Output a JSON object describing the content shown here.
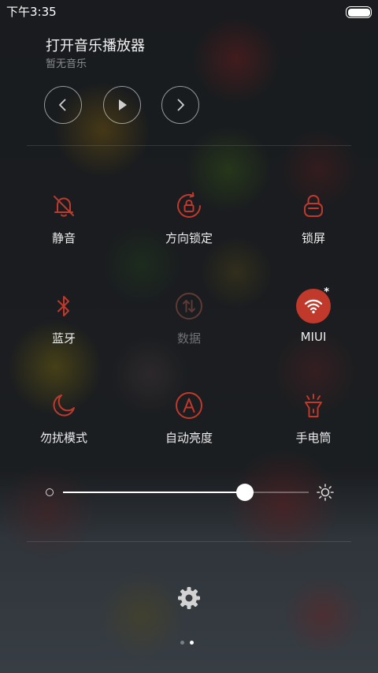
{
  "status_bar": {
    "time": "下午3:35"
  },
  "music": {
    "title": "打开音乐播放器",
    "subtitle": "暂无音乐",
    "buttons": [
      "chevron-left-icon",
      "play-icon",
      "chevron-right-icon"
    ]
  },
  "toggles": [
    {
      "label": "静音",
      "icon": "bell-off-icon",
      "active": false
    },
    {
      "label": "方向锁定",
      "icon": "rotation-lock-icon",
      "active": false
    },
    {
      "label": "锁屏",
      "icon": "lock-icon",
      "active": false
    },
    {
      "label": "蓝牙",
      "icon": "bluetooth-icon",
      "active": false
    },
    {
      "label": "数据",
      "icon": "mobile-data-icon",
      "active": false,
      "disabled": true
    },
    {
      "label": "MIUI",
      "icon": "wifi-icon",
      "active": true
    },
    {
      "label": "勿扰模式",
      "icon": "moon-icon",
      "active": false
    },
    {
      "label": "自动亮度",
      "icon": "auto-brightness-icon",
      "active": false
    },
    {
      "label": "手电筒",
      "icon": "flashlight-icon",
      "active": false
    }
  ],
  "brightness": {
    "level": 0.74
  },
  "page_indicator": {
    "count": 2,
    "current": 2
  },
  "colors": {
    "accent": "#c0392b",
    "icon_red": "#c0392b",
    "disabled": "#6f7275"
  }
}
